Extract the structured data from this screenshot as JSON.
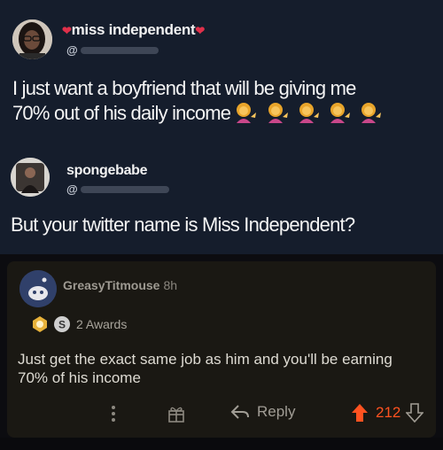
{
  "twitter": {
    "tweets": [
      {
        "name": "miss independent",
        "handle_prefix": "@",
        "text_line1": "I just want a boyfriend that will be giving me",
        "text_line2": "70% out of his daily income"
      },
      {
        "name": "spongebabe",
        "handle_prefix": "@",
        "text": "But your twitter name is Miss Independent?"
      }
    ],
    "emoji_icon": "woman-tipping-hand-icon",
    "emoji_count": 5
  },
  "reddit": {
    "comment": {
      "username": "GreasyTitmouse",
      "time": "8h",
      "awards": "2 Awards",
      "body": "Just get the exact same job as him and you'll be earning 70% of his income"
    },
    "actions": {
      "reply_label": "Reply",
      "score": "212"
    },
    "colors": {
      "upvote": "#ff5220",
      "background": "#1a1813"
    }
  }
}
